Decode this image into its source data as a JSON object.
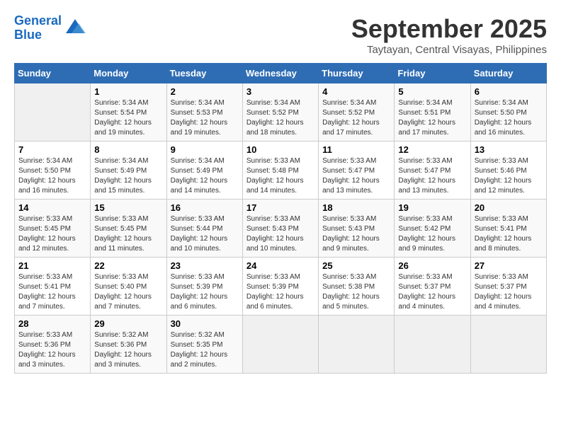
{
  "header": {
    "logo_line1": "General",
    "logo_line2": "Blue",
    "month": "September 2025",
    "location": "Taytayan, Central Visayas, Philippines"
  },
  "weekdays": [
    "Sunday",
    "Monday",
    "Tuesday",
    "Wednesday",
    "Thursday",
    "Friday",
    "Saturday"
  ],
  "weeks": [
    [
      {
        "day": "",
        "info": ""
      },
      {
        "day": "1",
        "info": "Sunrise: 5:34 AM\nSunset: 5:54 PM\nDaylight: 12 hours\nand 19 minutes."
      },
      {
        "day": "2",
        "info": "Sunrise: 5:34 AM\nSunset: 5:53 PM\nDaylight: 12 hours\nand 19 minutes."
      },
      {
        "day": "3",
        "info": "Sunrise: 5:34 AM\nSunset: 5:52 PM\nDaylight: 12 hours\nand 18 minutes."
      },
      {
        "day": "4",
        "info": "Sunrise: 5:34 AM\nSunset: 5:52 PM\nDaylight: 12 hours\nand 17 minutes."
      },
      {
        "day": "5",
        "info": "Sunrise: 5:34 AM\nSunset: 5:51 PM\nDaylight: 12 hours\nand 17 minutes."
      },
      {
        "day": "6",
        "info": "Sunrise: 5:34 AM\nSunset: 5:50 PM\nDaylight: 12 hours\nand 16 minutes."
      }
    ],
    [
      {
        "day": "7",
        "info": "Sunrise: 5:34 AM\nSunset: 5:50 PM\nDaylight: 12 hours\nand 16 minutes."
      },
      {
        "day": "8",
        "info": "Sunrise: 5:34 AM\nSunset: 5:49 PM\nDaylight: 12 hours\nand 15 minutes."
      },
      {
        "day": "9",
        "info": "Sunrise: 5:34 AM\nSunset: 5:49 PM\nDaylight: 12 hours\nand 14 minutes."
      },
      {
        "day": "10",
        "info": "Sunrise: 5:33 AM\nSunset: 5:48 PM\nDaylight: 12 hours\nand 14 minutes."
      },
      {
        "day": "11",
        "info": "Sunrise: 5:33 AM\nSunset: 5:47 PM\nDaylight: 12 hours\nand 13 minutes."
      },
      {
        "day": "12",
        "info": "Sunrise: 5:33 AM\nSunset: 5:47 PM\nDaylight: 12 hours\nand 13 minutes."
      },
      {
        "day": "13",
        "info": "Sunrise: 5:33 AM\nSunset: 5:46 PM\nDaylight: 12 hours\nand 12 minutes."
      }
    ],
    [
      {
        "day": "14",
        "info": "Sunrise: 5:33 AM\nSunset: 5:45 PM\nDaylight: 12 hours\nand 12 minutes."
      },
      {
        "day": "15",
        "info": "Sunrise: 5:33 AM\nSunset: 5:45 PM\nDaylight: 12 hours\nand 11 minutes."
      },
      {
        "day": "16",
        "info": "Sunrise: 5:33 AM\nSunset: 5:44 PM\nDaylight: 12 hours\nand 10 minutes."
      },
      {
        "day": "17",
        "info": "Sunrise: 5:33 AM\nSunset: 5:43 PM\nDaylight: 12 hours\nand 10 minutes."
      },
      {
        "day": "18",
        "info": "Sunrise: 5:33 AM\nSunset: 5:43 PM\nDaylight: 12 hours\nand 9 minutes."
      },
      {
        "day": "19",
        "info": "Sunrise: 5:33 AM\nSunset: 5:42 PM\nDaylight: 12 hours\nand 9 minutes."
      },
      {
        "day": "20",
        "info": "Sunrise: 5:33 AM\nSunset: 5:41 PM\nDaylight: 12 hours\nand 8 minutes."
      }
    ],
    [
      {
        "day": "21",
        "info": "Sunrise: 5:33 AM\nSunset: 5:41 PM\nDaylight: 12 hours\nand 7 minutes."
      },
      {
        "day": "22",
        "info": "Sunrise: 5:33 AM\nSunset: 5:40 PM\nDaylight: 12 hours\nand 7 minutes."
      },
      {
        "day": "23",
        "info": "Sunrise: 5:33 AM\nSunset: 5:39 PM\nDaylight: 12 hours\nand 6 minutes."
      },
      {
        "day": "24",
        "info": "Sunrise: 5:33 AM\nSunset: 5:39 PM\nDaylight: 12 hours\nand 6 minutes."
      },
      {
        "day": "25",
        "info": "Sunrise: 5:33 AM\nSunset: 5:38 PM\nDaylight: 12 hours\nand 5 minutes."
      },
      {
        "day": "26",
        "info": "Sunrise: 5:33 AM\nSunset: 5:37 PM\nDaylight: 12 hours\nand 4 minutes."
      },
      {
        "day": "27",
        "info": "Sunrise: 5:33 AM\nSunset: 5:37 PM\nDaylight: 12 hours\nand 4 minutes."
      }
    ],
    [
      {
        "day": "28",
        "info": "Sunrise: 5:33 AM\nSunset: 5:36 PM\nDaylight: 12 hours\nand 3 minutes."
      },
      {
        "day": "29",
        "info": "Sunrise: 5:32 AM\nSunset: 5:36 PM\nDaylight: 12 hours\nand 3 minutes."
      },
      {
        "day": "30",
        "info": "Sunrise: 5:32 AM\nSunset: 5:35 PM\nDaylight: 12 hours\nand 2 minutes."
      },
      {
        "day": "",
        "info": ""
      },
      {
        "day": "",
        "info": ""
      },
      {
        "day": "",
        "info": ""
      },
      {
        "day": "",
        "info": ""
      }
    ]
  ]
}
